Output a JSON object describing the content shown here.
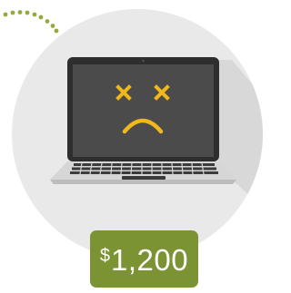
{
  "illustration": {
    "subject": "laptop-sad-face",
    "colors": {
      "circle": "#e9e9e9",
      "shadow": "#d6d6d6",
      "dots": "#94aa3c",
      "laptop_frame": "#2e2e2e",
      "screen": "#4a4a4a",
      "face": "#f0b81c",
      "keyboard_base": "#d4d4d4",
      "keys": "#3a3a3a"
    }
  },
  "price": {
    "currency": "$",
    "amount": "1,200",
    "badge_color": "#7c9334"
  }
}
